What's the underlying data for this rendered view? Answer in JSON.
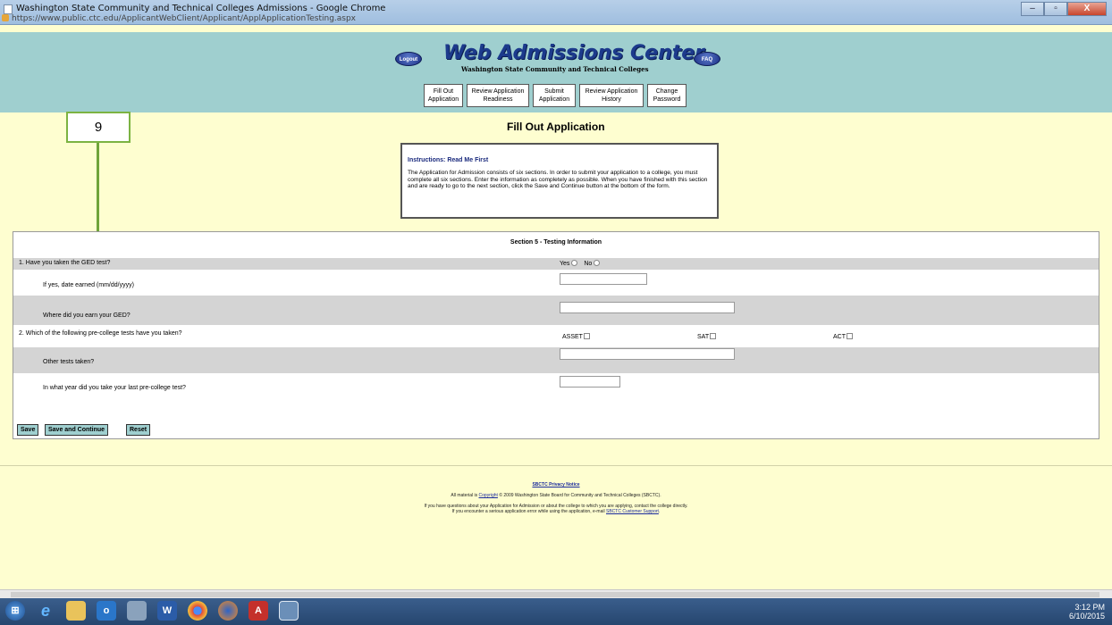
{
  "window": {
    "title": "Washington State Community and Technical Colleges Admissions - Google Chrome",
    "url": "https://www.public.ctc.edu/ApplicantWebClient/Applicant/ApplApplicationTesting.aspx",
    "minimize_icon": "minimize-icon",
    "maximize_icon": "maximize-icon",
    "close_label": "X"
  },
  "header": {
    "brand_title": "Web Admissions Center",
    "brand_subtitle": "Washington State Community and Technical Colleges",
    "logout_label": "Logout",
    "faq_label": "FAQ",
    "tabs": [
      {
        "label": "Fill Out Application"
      },
      {
        "label": "Review Application Readiness"
      },
      {
        "label": "Submit Application"
      },
      {
        "label": "Review Application History"
      },
      {
        "label": "Change Password"
      }
    ]
  },
  "annotation": {
    "step_number": "9"
  },
  "main": {
    "page_title": "Fill Out Application",
    "instructions_heading": "Instructions: Read Me First",
    "instructions_body": "The Application for Admission consists of six sections. In order to submit your application to a college, you must complete all six sections. Enter the information as completely as possible. When you have finished with this section and are ready to go to the next section, click the Save and Continue button at the bottom of the form."
  },
  "form": {
    "section_title": "Section 5 - Testing Information",
    "q1_label": "1. Have you taken the GED test?",
    "q1_yes": "Yes",
    "q1_no": "No",
    "ged_date_label": "If yes, date earned (mm/dd/yyyy)",
    "ged_date_value": "",
    "ged_where_label": "Where did you earn your GED?",
    "ged_where_value": "",
    "q2_label": "2. Which of the following pre-college tests have you taken?",
    "test_asset": "ASSET",
    "test_sat": "SAT",
    "test_act": "ACT",
    "other_tests_label": "Other tests taken?",
    "other_tests_value": "",
    "last_year_label": "In what year did you take your last pre-college test?",
    "last_year_value": "",
    "save_label": "Save",
    "save_continue_label": "Save and Continue",
    "reset_label": "Reset"
  },
  "footer": {
    "privacy_link": "SBCTC Privacy Notice",
    "copyright_prefix": "All material is",
    "copyright_link": "Copyright",
    "copyright_suffix": "© 2009 Washington State Board for Community and Technical Colleges (SBCTC).",
    "help_line1": "If you have questions about your Application for Admission or about the college to which you are applying, contact the college directly.",
    "help_line2_prefix": "If you encounter a serious application error while using the application, e-mail",
    "support_link": "SBCTC Customer Support"
  },
  "taskbar": {
    "time": "3:12 PM",
    "date": "6/10/2015",
    "icons": [
      "windows-start-icon",
      "ie-icon",
      "explorer-icon",
      "outlook-icon",
      "calculator-icon",
      "word-icon",
      "chrome-icon",
      "firefox-icon",
      "acrobat-icon",
      "window-icon"
    ]
  }
}
